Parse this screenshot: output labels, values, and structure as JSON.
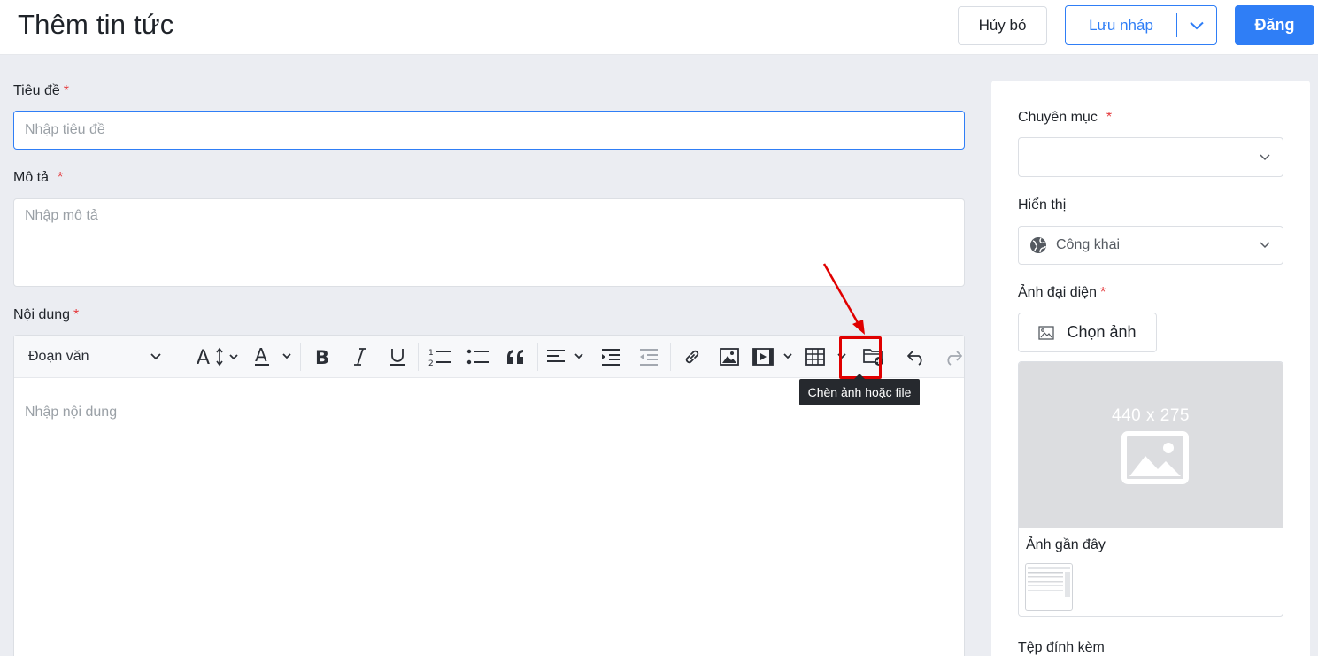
{
  "header": {
    "title": "Thêm tin tức",
    "cancel_label": "Hủy bỏ",
    "draft_label": "Lưu nháp",
    "post_label": "Đăng"
  },
  "form": {
    "title_label": "Tiêu đề",
    "title_placeholder": "Nhập tiêu đề",
    "desc_label": "Mô tả",
    "desc_placeholder": "Nhập mô tả",
    "content_label": "Nội dung",
    "content_placeholder": "Nhập nội dung",
    "required_mark": "*"
  },
  "editor": {
    "paragraph_select": "Đoạn văn",
    "tooltip": "Chèn ảnh hoặc file",
    "toolbar_icons": [
      "font-size-icon",
      "font-color-icon",
      "bold-icon",
      "italic-icon",
      "underline-icon",
      "numbered-list-icon",
      "bulleted-list-icon",
      "blockquote-icon",
      "align-icon",
      "indent-icon",
      "outdent-icon",
      "link-icon",
      "image-icon",
      "media-icon",
      "table-icon",
      "insert-file-icon",
      "undo-icon",
      "redo-icon"
    ]
  },
  "sidebar": {
    "category_label": "Chuyên mục",
    "category_value": "",
    "visibility_label": "Hiển thị",
    "visibility_value": "Công khai",
    "avatar_label": "Ảnh đại diện",
    "choose_image_label": "Chọn ảnh",
    "placeholder_size": "440 x 275",
    "recent_label": "Ảnh gần đây",
    "attachments_label": "Tệp đính kèm"
  },
  "colors": {
    "primary": "#2f7ef6",
    "required": "#e4393c",
    "highlight": "#e00000"
  }
}
